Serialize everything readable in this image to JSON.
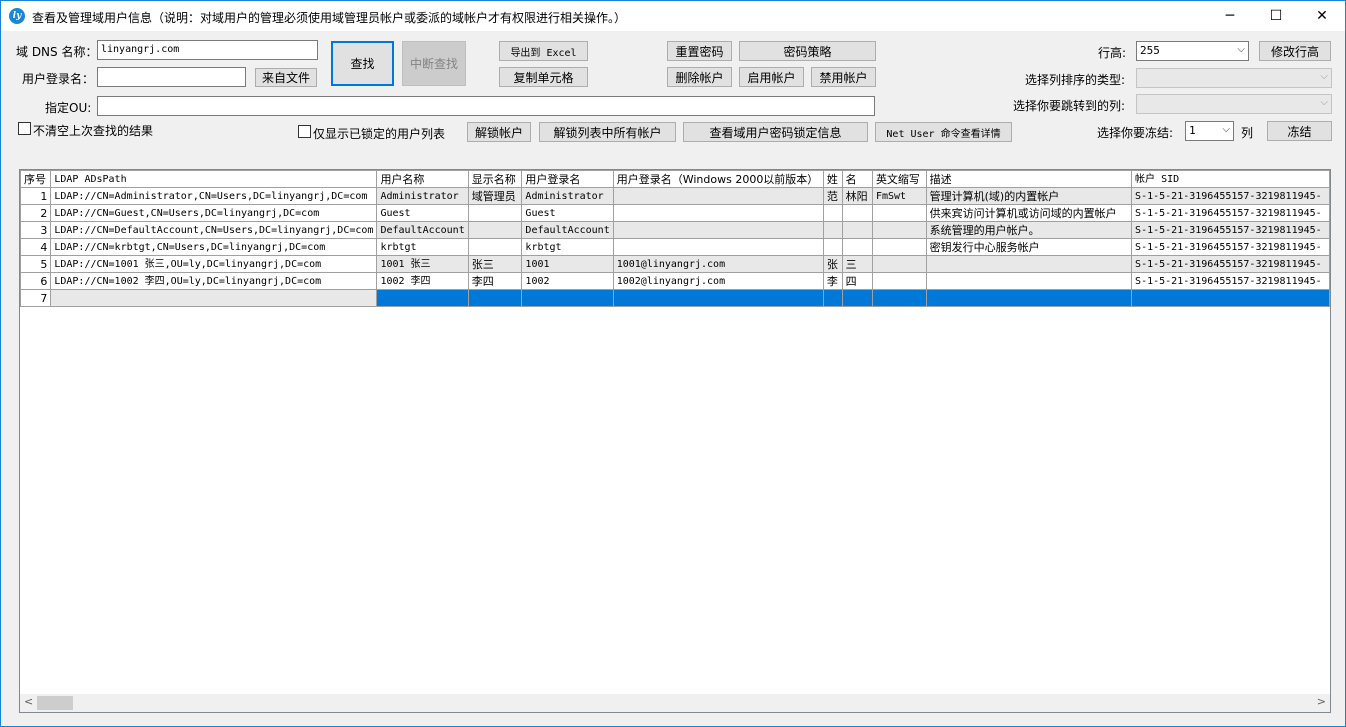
{
  "window": {
    "title": "查看及管理域用户信息（说明：对域用户的管理必须使用域管理员帐户或委派的域帐户才有权限进行相关操作。）",
    "minimize": "─",
    "maximize": "☐",
    "close": "✕"
  },
  "form": {
    "dns_label": "域 DNS 名称：",
    "dns_value": "linyangrj.com",
    "login_label": "用户登录名：",
    "login_value": "",
    "ou_label": "指定OU:",
    "ou_value": "",
    "from_file": "来自文件",
    "search": "查找",
    "stop_search": "中断查找",
    "export_excel": "导出到 Excel",
    "copy_cell": "复制单元格",
    "reset_password": "重置密码",
    "password_policy": "密码策略",
    "delete_account": "删除帐户",
    "enable_account": "启用帐户",
    "disable_account": "禁用帐户",
    "keep_results": "不清空上次查找的结果",
    "only_locked": "仅显示已锁定的用户列表",
    "unlock_account": "解锁帐户",
    "unlock_all": "解锁列表中所有帐户",
    "view_lock_info": "查看域用户密码锁定信息",
    "net_user": "Net User 命令查看详情",
    "row_height_label": "行高:",
    "row_height_value": "255",
    "modify_row_height": "修改行高",
    "sort_type_label": "选择列排序的类型:",
    "jump_column_label": "选择你要跳转到的列:",
    "freeze_label": "选择你要冻结:",
    "freeze_value": "1",
    "freeze_unit": "列",
    "freeze": "冻结",
    "dropdown_arrow": "⌵"
  },
  "grid": {
    "columns": [
      "序号",
      "LDAP ADsPath",
      "用户名称",
      "显示名称",
      "用户登录名",
      "用户登录名（Windows 2000以前版本）",
      "姓",
      "名",
      "英文缩写",
      "描述",
      "帐户 SID"
    ],
    "rows": [
      [
        "1",
        "LDAP://CN=Administrator,CN=Users,DC=linyangrj,DC=com",
        "Administrator",
        "域管理员",
        "Administrator",
        "",
        "范",
        "林阳",
        "FmSwt",
        "管理计算机(域)的内置帐户",
        "S-1-5-21-3196455157-3219811945-"
      ],
      [
        "2",
        "LDAP://CN=Guest,CN=Users,DC=linyangrj,DC=com",
        "Guest",
        "",
        "Guest",
        "",
        "",
        "",
        "",
        "供来宾访问计算机或访问域的内置帐户",
        "S-1-5-21-3196455157-3219811945-"
      ],
      [
        "3",
        "LDAP://CN=DefaultAccount,CN=Users,DC=linyangrj,DC=com",
        "DefaultAccount",
        "",
        "DefaultAccount",
        "",
        "",
        "",
        "",
        "系统管理的用户帐户。",
        "S-1-5-21-3196455157-3219811945-"
      ],
      [
        "4",
        "LDAP://CN=krbtgt,CN=Users,DC=linyangrj,DC=com",
        "krbtgt",
        "",
        "krbtgt",
        "",
        "",
        "",
        "",
        "密钥发行中心服务帐户",
        "S-1-5-21-3196455157-3219811945-"
      ],
      [
        "5",
        "LDAP://CN=1001 张三,OU=ly,DC=linyangrj,DC=com",
        "1001 张三",
        "张三",
        "1001",
        "1001@linyangrj.com",
        "张",
        "三",
        "",
        "",
        "S-1-5-21-3196455157-3219811945-"
      ],
      [
        "6",
        "LDAP://CN=1002 李四,OU=ly,DC=linyangrj,DC=com",
        "1002 李四",
        "李四",
        "1002",
        "1002@linyangrj.com",
        "李",
        "四",
        "",
        "",
        "S-1-5-21-3196455157-3219811945-"
      ],
      [
        "7",
        "",
        "",
        "",
        "",
        "",
        "",
        "",
        "",
        "",
        ""
      ]
    ]
  },
  "scrollbar": {
    "left": "<",
    "right": ">"
  },
  "colors": {
    "selection": "#0078d7",
    "accent": "#1883d7"
  }
}
